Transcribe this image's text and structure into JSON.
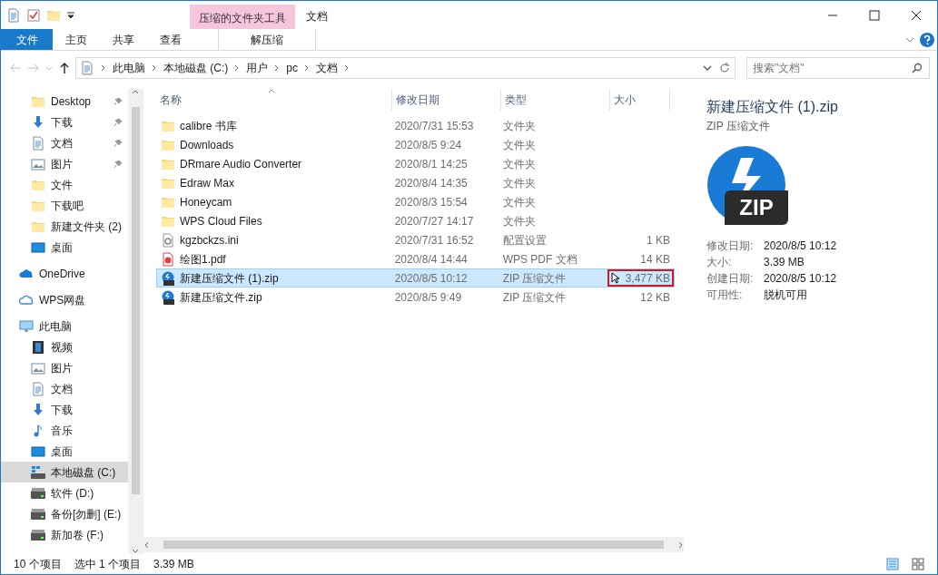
{
  "title_bar": {
    "context_tab": "压缩的文件夹工具",
    "title": "文档"
  },
  "ribbon_tabs": [
    {
      "label": "文件",
      "kind": "file",
      "selected": false
    },
    {
      "label": "主页",
      "kind": "tab",
      "selected": false
    },
    {
      "label": "共享",
      "kind": "tab",
      "selected": false
    },
    {
      "label": "查看",
      "kind": "tab",
      "selected": false
    },
    {
      "label": "解压缩",
      "kind": "context",
      "selected": false
    }
  ],
  "address": {
    "crumbs": [
      "此电脑",
      "本地磁盘 (C:)",
      "用户",
      "pc",
      "文档"
    ]
  },
  "search": {
    "placeholder": "搜索\"文档\""
  },
  "sidebar": {
    "quick_access": [
      {
        "label": "Desktop",
        "kind": "folder",
        "pinned": true
      },
      {
        "label": "下载",
        "kind": "download",
        "pinned": true
      },
      {
        "label": "文档",
        "kind": "document",
        "pinned": true
      },
      {
        "label": "图片",
        "kind": "picture",
        "pinned": true
      },
      {
        "label": "文件",
        "kind": "folder",
        "pinned": false
      },
      {
        "label": "下载吧",
        "kind": "folder",
        "pinned": false
      },
      {
        "label": "新建文件夹 (2)",
        "kind": "folder",
        "pinned": false
      },
      {
        "label": "桌面",
        "kind": "desktop",
        "pinned": false
      }
    ],
    "items": [
      {
        "label": "OneDrive",
        "kind": "onedrive",
        "selected": false
      },
      {
        "label": "WPS网盘",
        "kind": "cloud",
        "selected": false
      },
      {
        "label": "此电脑",
        "kind": "pc",
        "selected": false,
        "children": [
          {
            "label": "视频",
            "kind": "video",
            "selected": false
          },
          {
            "label": "图片",
            "kind": "picture",
            "selected": false
          },
          {
            "label": "文档",
            "kind": "document",
            "selected": false
          },
          {
            "label": "下载",
            "kind": "download",
            "selected": false
          },
          {
            "label": "音乐",
            "kind": "music",
            "selected": false
          },
          {
            "label": "桌面",
            "kind": "desktop",
            "selected": false
          },
          {
            "label": "本地磁盘 (C:)",
            "kind": "windrive",
            "selected": true
          },
          {
            "label": "软件 (D:)",
            "kind": "drive",
            "selected": false
          },
          {
            "label": "备份[勿删] (E:)",
            "kind": "drive",
            "selected": false
          },
          {
            "label": "新加卷 (F:)",
            "kind": "drive",
            "selected": false
          }
        ]
      }
    ]
  },
  "files": {
    "columns": [
      "名称",
      "修改日期",
      "类型",
      "大小"
    ],
    "rows": [
      {
        "name": "calibre 书库",
        "date": "2020/7/31 15:53",
        "type": "文件夹",
        "kind": "folder",
        "selected": false,
        "highlighted": false
      },
      {
        "name": "Downloads",
        "date": "2020/8/5 9:24",
        "type": "文件夹",
        "kind": "folder",
        "selected": false,
        "highlighted": false
      },
      {
        "name": "DRmare Audio Converter",
        "date": "2020/8/1 14:25",
        "type": "文件夹",
        "kind": "folder",
        "selected": false,
        "highlighted": false
      },
      {
        "name": "Edraw Max",
        "date": "2020/8/4 14:35",
        "type": "文件夹",
        "kind": "folder",
        "selected": false,
        "highlighted": false
      },
      {
        "name": "Honeycam",
        "date": "2020/8/3 15:54",
        "type": "文件夹",
        "kind": "folder",
        "selected": false,
        "highlighted": false
      },
      {
        "name": "WPS Cloud Files",
        "date": "2020/7/27 14:17",
        "type": "文件夹",
        "kind": "folder",
        "selected": false,
        "highlighted": false
      },
      {
        "name": "kgzbckzs.ini",
        "date": "2020/7/31 16:52",
        "type": "配置设置",
        "size": "1 KB",
        "kind": "ini",
        "selected": false,
        "highlighted": false
      },
      {
        "name": "绘图1.pdf",
        "date": "2020/8/4 14:44",
        "type": "WPS PDF 文档",
        "size": "14 KB",
        "kind": "pdf",
        "selected": false,
        "highlighted": false
      },
      {
        "name": "新建压缩文件 (1).zip",
        "date": "2020/8/5 10:12",
        "type": "ZIP 压缩文件",
        "size": "3,477 KB",
        "kind": "zip",
        "selected": true,
        "highlighted": true
      },
      {
        "name": "新建压缩文件.zip",
        "date": "2020/8/5 9:49",
        "type": "ZIP 压缩文件",
        "size": "12 KB",
        "kind": "zip",
        "selected": false,
        "highlighted": false
      }
    ]
  },
  "preview": {
    "name": "新建压缩文件 (1).zip",
    "type": "ZIP 压缩文件",
    "icon_label": "ZIP",
    "properties": [
      {
        "label": "修改日期:",
        "value": "2020/8/5 10:12"
      },
      {
        "label": "大小:",
        "value": "3.39 MB"
      },
      {
        "label": "创建日期:",
        "value": "2020/8/5 10:12"
      },
      {
        "label": "可用性:",
        "value": "脱机可用"
      }
    ]
  },
  "status_bar": {
    "count": "10 个项目",
    "selection": "选中 1 个项目",
    "size": "3.39 MB"
  }
}
